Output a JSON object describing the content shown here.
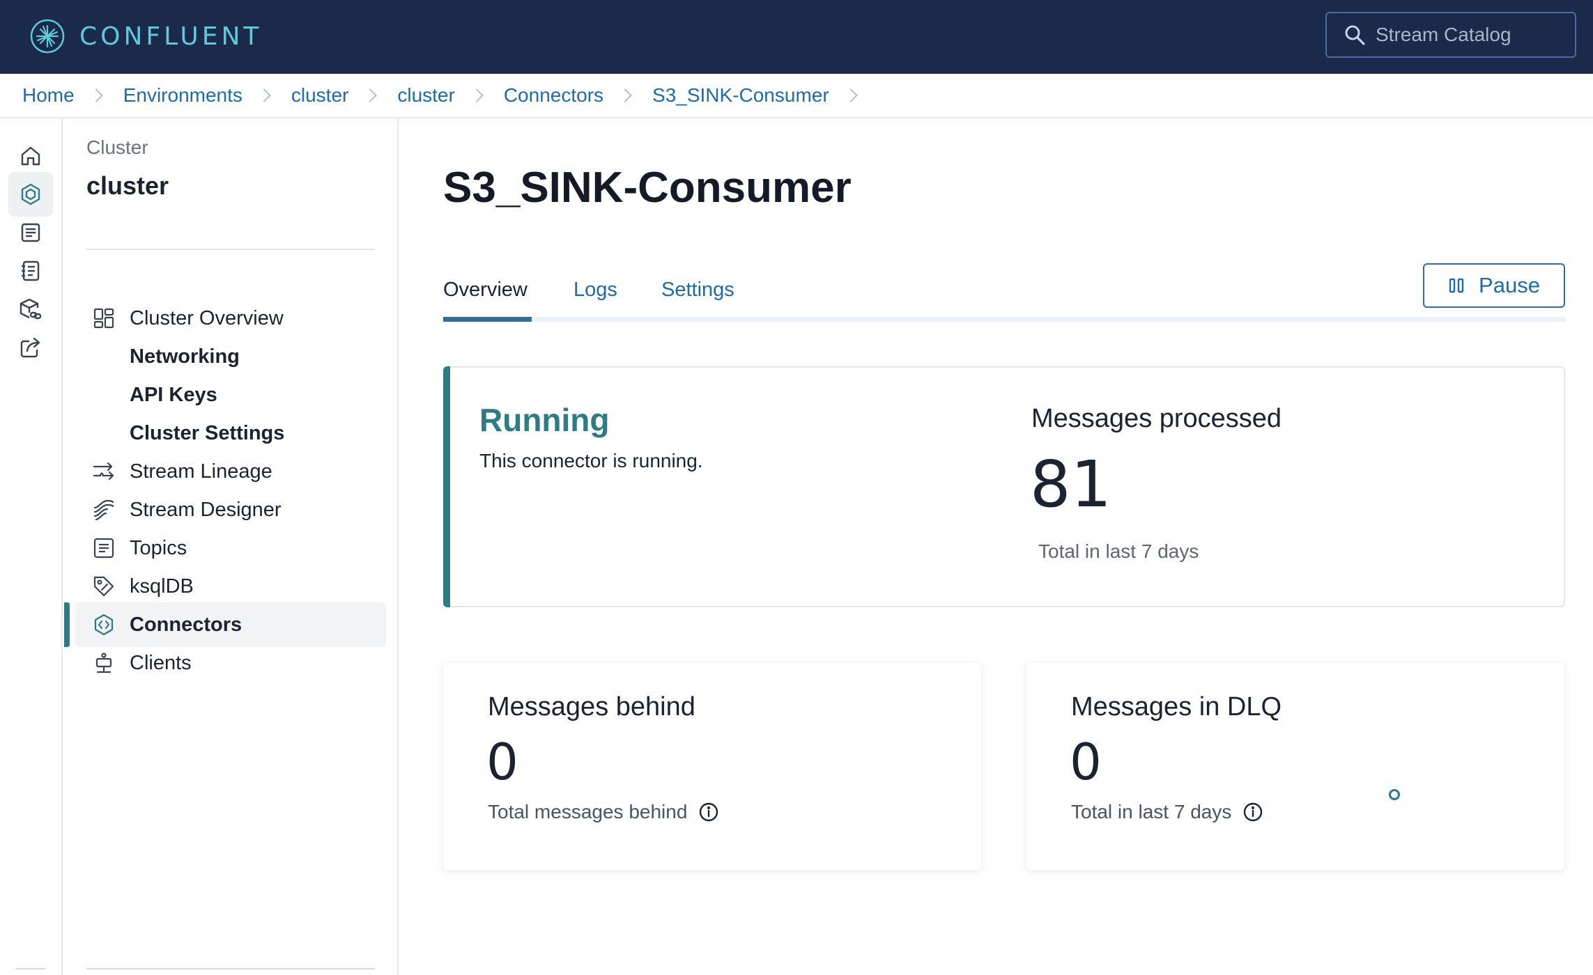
{
  "topbar": {
    "brand": "CONFLUENT",
    "search_placeholder": "Stream Catalog"
  },
  "breadcrumb": [
    "Home",
    "Environments",
    "cluster",
    "cluster",
    "Connectors",
    "S3_SINK-Consumer"
  ],
  "rail": {
    "icons": [
      "home-icon",
      "cluster-hex-icon",
      "document-icon",
      "notebook-icon",
      "package-link-icon",
      "share-icon"
    ],
    "active_index": 1
  },
  "sidenav": {
    "kicker": "Cluster",
    "cluster_name": "cluster",
    "items": [
      {
        "label": "Cluster Overview",
        "icon": "dashboard-icon"
      },
      {
        "label": "Networking",
        "icon": ""
      },
      {
        "label": "API Keys",
        "icon": ""
      },
      {
        "label": "Cluster Settings",
        "icon": ""
      },
      {
        "label": "Stream Lineage",
        "icon": "lineage-arrows-icon"
      },
      {
        "label": "Stream Designer",
        "icon": "designer-waves-icon"
      },
      {
        "label": "Topics",
        "icon": "topics-document-icon"
      },
      {
        "label": "ksqlDB",
        "icon": "ksqldb-tag-icon"
      },
      {
        "label": "Connectors",
        "icon": "connector-hex-icon"
      },
      {
        "label": "Clients",
        "icon": "clients-icon"
      }
    ],
    "active_item": "Connectors"
  },
  "main": {
    "title": "S3_SINK-Consumer",
    "tabs": [
      "Overview",
      "Logs",
      "Settings"
    ],
    "active_tab": "Overview",
    "pause_label": "Pause",
    "status": {
      "title": "Running",
      "description": "This connector is running.",
      "messages_processed_label": "Messages processed",
      "messages_processed_value": "81",
      "messages_processed_note": "Total in last 7 days"
    },
    "metrics": [
      {
        "title": "Messages behind",
        "value": "0",
        "note": "Total messages behind"
      },
      {
        "title": "Messages in DLQ",
        "value": "0",
        "note": "Total in last 7 days"
      }
    ]
  },
  "colors": {
    "topbar_bg": "#1b2a4a",
    "brand_accent": "#5fc9d8",
    "link": "#1f6aa8",
    "running_teal": "#2d7b86"
  }
}
